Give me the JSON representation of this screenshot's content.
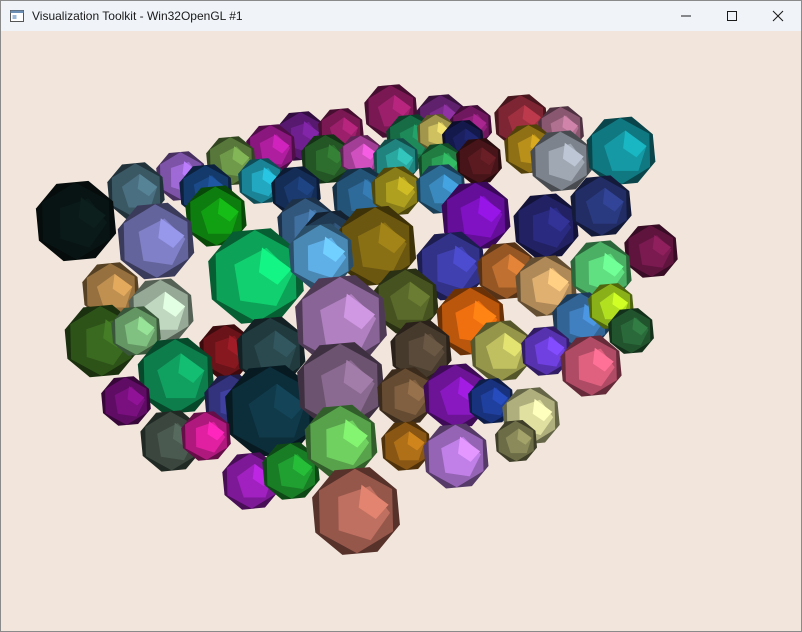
{
  "window": {
    "title": "Visualization Toolkit - Win32OpenGL #1",
    "background_color": "#f2e6dc",
    "titlebar_color": "#f0f4f9"
  },
  "caption_buttons": {
    "minimize_icon": "minimize-icon",
    "maximize_icon": "maximize-icon",
    "close_icon": "close-icon"
  },
  "viewport": {
    "content": "3D rendering of many colored polyhedral cells (truncated-octahedron style) packed in a block"
  }
}
